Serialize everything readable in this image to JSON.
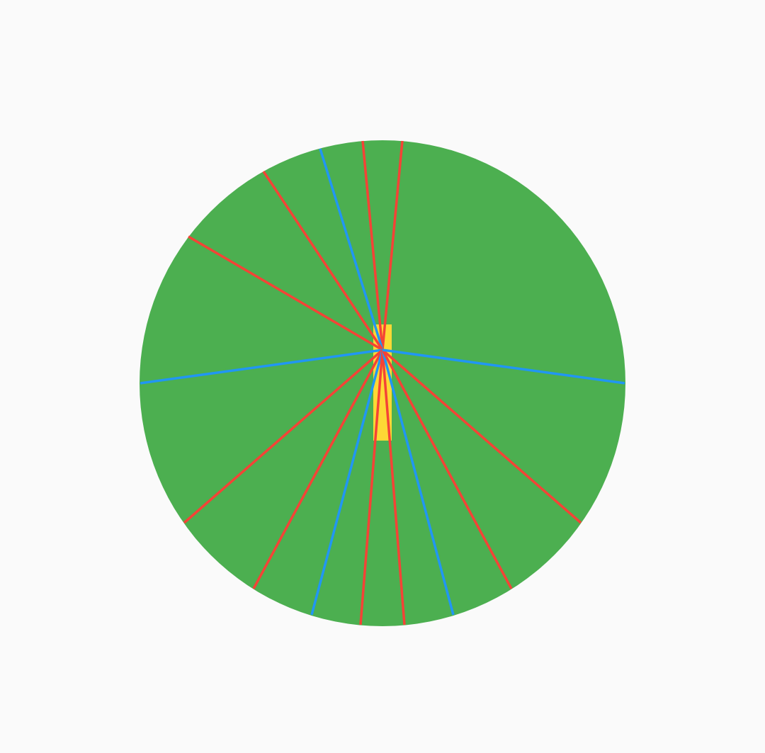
{
  "colors": {
    "background": "#fafafa",
    "disk": "#4caf50",
    "hub": "#fdd835",
    "red_ray": "#f44336",
    "blue_ray": "#2196f3"
  },
  "rays": [
    {
      "color": "red"
    },
    {
      "color": "red"
    },
    {
      "color": "blue"
    },
    {
      "color": "red"
    },
    {
      "color": "red"
    },
    {
      "color": "blue"
    },
    {
      "color": "red"
    },
    {
      "color": "red"
    },
    {
      "color": "blue"
    },
    {
      "color": "red"
    },
    {
      "color": "red"
    },
    {
      "color": "blue"
    },
    {
      "color": "red"
    },
    {
      "color": "red"
    }
  ]
}
